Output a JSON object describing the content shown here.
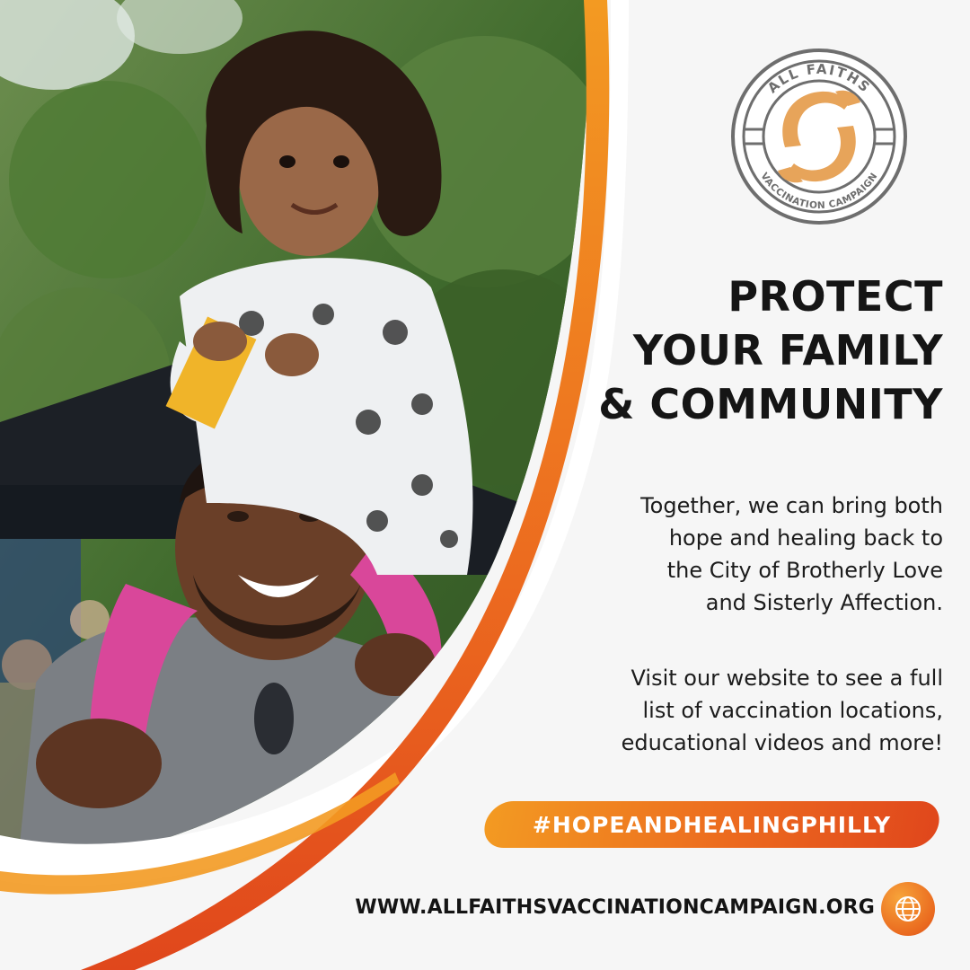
{
  "logo": {
    "top_text": "ALL FAITHS",
    "bottom_text": "VACCINATION CAMPAIGN",
    "icon": "hands-circle-icon"
  },
  "headline": {
    "line1": "PROTECT",
    "line2": "YOUR FAMILY",
    "line3": "& COMMUNITY"
  },
  "body": {
    "paragraph1": [
      "Together, we can bring both",
      "hope and healing back to",
      "the City of Brotherly Love",
      "and Sisterly Affection."
    ],
    "paragraph2": [
      "Visit our website to see a full",
      "list of vaccination locations,",
      "educational videos and more!"
    ]
  },
  "hashtag": "#HOPEANDHEALINGPHILLY",
  "website": "WWW.ALLFAITHSVACCINATIONCAMPAIGN.ORG",
  "icons": {
    "globe": "globe-icon"
  },
  "colors": {
    "accent_orange": "#ec6a1f",
    "accent_light": "#f39a22",
    "accent_dark": "#e0471c",
    "logo_gray": "#6e6e6e",
    "logo_tan": "#e7a45a",
    "text": "#151515"
  }
}
